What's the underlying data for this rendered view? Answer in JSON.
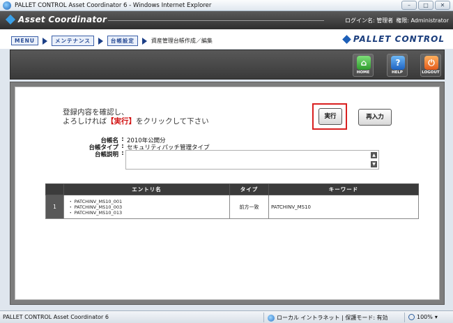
{
  "window": {
    "title": "PALLET CONTROL Asset Coordinator 6 - Windows Internet Explorer",
    "controls": {
      "minimize": "–",
      "maximize": "□",
      "close": "✕"
    }
  },
  "header": {
    "logo_text": "Asset Coordinator",
    "login_label": "ログイン名: 管理者",
    "role_label": "権限: Administrator"
  },
  "breadcrumb": {
    "items": [
      "MENU",
      "メンテナンス",
      "台帳設定"
    ],
    "current": "資産管理台帳作成／編集"
  },
  "brand": {
    "text": "PALLET CONTROL"
  },
  "toolbar": {
    "home_label": "HOME",
    "help_label": "HELP",
    "logout_label": "LOGOUT",
    "home_glyph": "⌂",
    "help_glyph": "?",
    "logout_glyph": "⏻"
  },
  "instruction": {
    "line1": "登録内容を確認し、",
    "line2_prefix": "よろしければ",
    "line2_emph": "【実行】",
    "line2_suffix": "をクリックして下さい"
  },
  "buttons": {
    "execute": "実行",
    "reenter": "再入力"
  },
  "ledger": {
    "name_label": "台帳名",
    "name_value": "2010年公開分",
    "type_label": "台帳タイプ",
    "type_value": "セキュリティパッチ管理タイプ",
    "desc_label": "台帳説明",
    "desc_value": "",
    "separator": ":"
  },
  "table": {
    "headers": {
      "entry": "エントリ名",
      "type": "タイプ",
      "keyword": "キーワード"
    },
    "rows": [
      {
        "num": "1",
        "entries": [
          "・ PATCHINV_MS10_001",
          "・ PATCHINV_MS10_003",
          "・ PATCHINV_MS10_013"
        ],
        "type": "前方一致",
        "keyword": "PATCHINV_MS10"
      }
    ]
  },
  "statusbar": {
    "left": "PALLET CONTROL Asset Coordinator 6",
    "zone": "ローカル イントラネット | 保護モード: 有効",
    "zoom": "100%"
  },
  "colors": {
    "accent_red": "#d92020",
    "brand_blue": "#1a3d7c",
    "header_dark": "#3a3a3a"
  }
}
